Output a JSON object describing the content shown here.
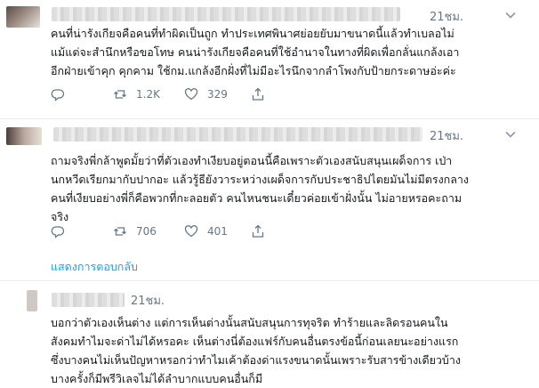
{
  "tweets": [
    {
      "time": "21ชม.",
      "lines": [
        "คนที่น่ารังเกียจคือคนที่ทำผิดเป็นถูก ทำประเทศพินาศย่อยยับมาขนาดนี้แล้วทำเบลอไม่",
        "แม้แต่จะสำนึกหรือขอโทษ คนน่ารังเกียจคือคนที่ใช้อำนาจในทางที่ผิดเพื่อกลั่นแกล้งเอา",
        "อีกฝ่ายเข้าคุก คุกคาม ใช้กม.แกล้งอีกฝั่งที่ไม่มีอะไรนึกจากลำโพงกับป้ายกระดาษอ่ะค่ะ"
      ],
      "reply_count": "",
      "retweet_count": "1.2K",
      "like_count": "329"
    },
    {
      "time": "21ชม.",
      "lines": [
        "ถามจริงพี่กล้าพูดมั้ยว่าที่ตัวเองทำเงียบอยู่ตอนนี้คือเพราะตัวเองสนับสนุนเผด็จการ เป่า",
        "นกหวีดเรียกมากับปากอะ แล้วรู้ธียังวาระหว่างเผด็จการกับประชาธิปไตยมันไม่มีตรงกลาง",
        "คนที่เงียบอย่างพี่ก็คือพวกที่กะลอยตัว คนไหนชนะเดี๋ยวค่อยเข้าฝั่งนั้น ไม่อายหรอคะถาม",
        "จริง"
      ],
      "reply_count": "",
      "retweet_count": "706",
      "like_count": "401",
      "show_replies": "แสดงการตอบกลับ"
    },
    {
      "time": "21ชม.",
      "lines": [
        "บอกว่าตัวเองเห็นต่าง แต่การเห็นต่างนั้นสนับสนุนการทุจริต ทำร้ายและลิดรอนคนใน",
        "สังคมทำไมจะด่าไม่ได้หรอคะ เห็นต่างนี่ต้องแฟร์กับคนอื่นตรงข้อนี้ก่อนเลยนะอย่างแรก",
        "ซึ่งบางคนไม่เห็นปัญหาหรอกว่าทำไมเค้าต้องด่าแรงขนาดนั้นเพราะรับสารข้างเดียวบ้าง",
        "บางครั้งก็มีพรีวิเลจไม่ได้ลำบากแบบคนอื่นก็มี"
      ]
    }
  ],
  "icons": {
    "reply": "reply-icon",
    "retweet": "retweet-icon",
    "like": "heart-icon",
    "share": "share-icon",
    "menu": "chevron-down-icon"
  },
  "colors": {
    "text": "#14171a",
    "meta": "#657786",
    "link": "#1da1f2",
    "divider": "#e6ecf0"
  }
}
